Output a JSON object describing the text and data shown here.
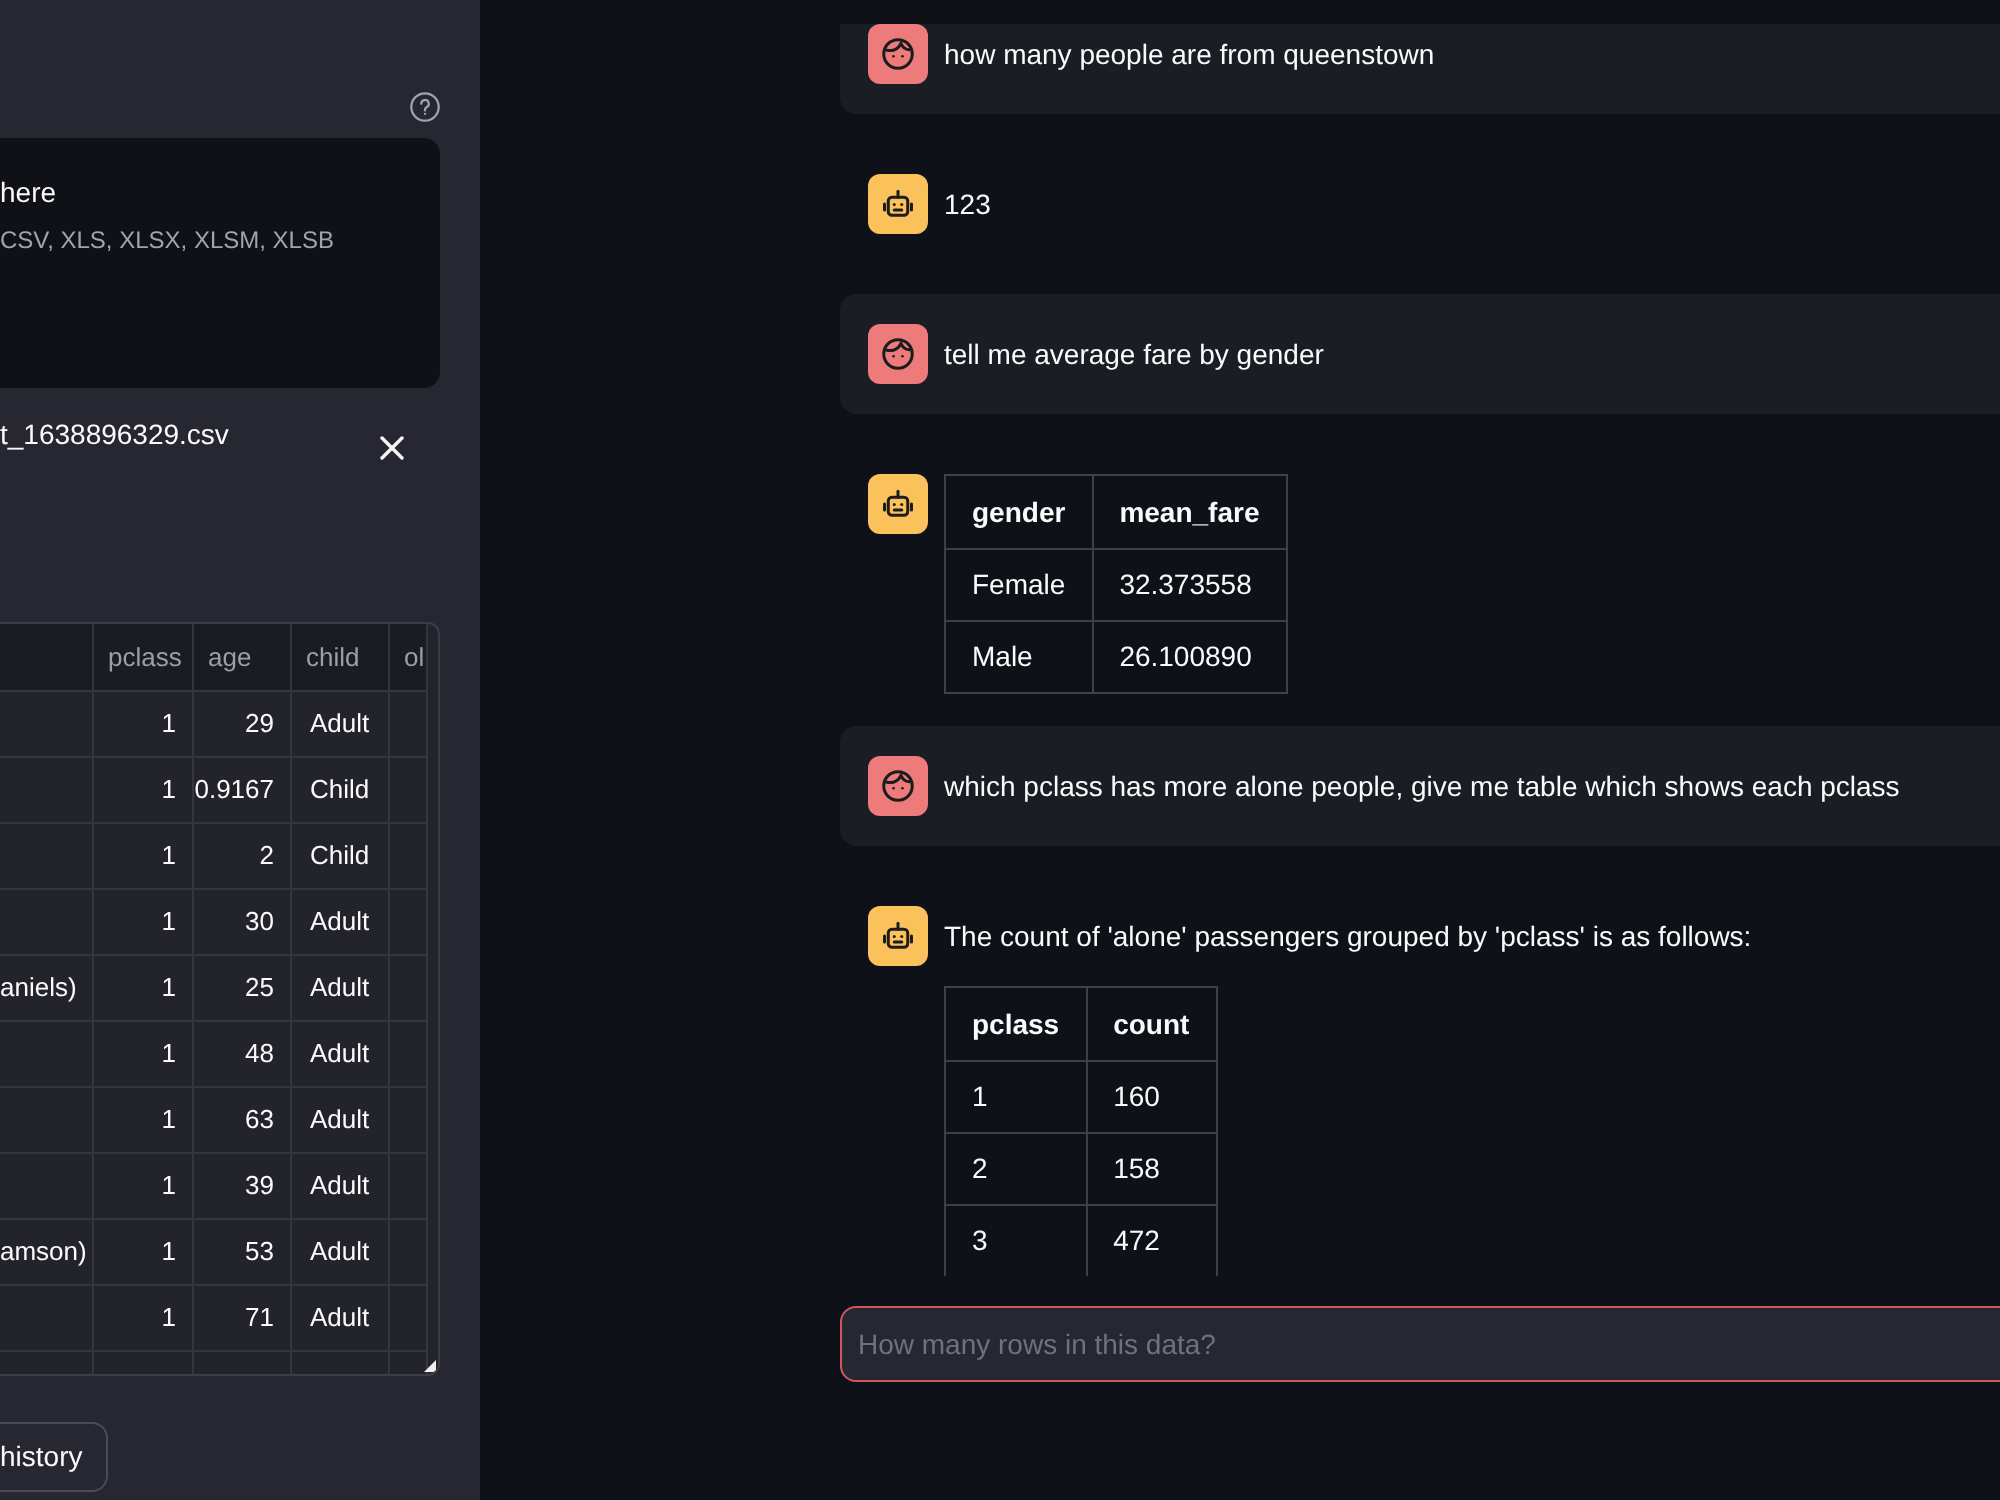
{
  "sidebar": {
    "uploader": {
      "title": "here",
      "hint": "CSV, XLS, XLSX, XLSM, XLSB"
    },
    "uploaded_file": {
      "name": "t_1638896329.csv"
    },
    "data_table": {
      "columns": [
        "pclass",
        "age",
        "child",
        "ol"
      ],
      "rows": [
        {
          "cells": [
            "1",
            "29",
            "Adult"
          ]
        },
        {
          "cells": [
            "1",
            "0.9167",
            "Child"
          ]
        },
        {
          "cells": [
            "1",
            "2",
            "Child"
          ]
        },
        {
          "cells": [
            "1",
            "30",
            "Adult"
          ]
        },
        {
          "column_1": "aniels)",
          "cells": [
            "1",
            "25",
            "Adult"
          ]
        },
        {
          "cells": [
            "1",
            "48",
            "Adult"
          ]
        },
        {
          "cells": [
            "1",
            "63",
            "Adult"
          ]
        },
        {
          "cells": [
            "1",
            "39",
            "Adult"
          ]
        },
        {
          "column_1": "amson)",
          "cells": [
            "1",
            "53",
            "Adult"
          ]
        },
        {
          "cells": [
            "1",
            "71",
            "Adult"
          ]
        }
      ]
    },
    "button": "history"
  },
  "chat": {
    "messages": [
      {
        "kind": "user",
        "text": "how many people are from queenstown"
      },
      {
        "kind": "assistant",
        "text": "123"
      },
      {
        "kind": "user",
        "text": "tell me average fare by gender"
      },
      {
        "kind": "assistant",
        "table": {
          "columns": [
            "gender",
            "mean_fare"
          ],
          "rows": [
            [
              "Female",
              "32.373558"
            ],
            [
              "Male",
              "26.100890"
            ]
          ]
        }
      },
      {
        "kind": "user",
        "text": "which pclass has more alone people, give me table which shows each pclass"
      },
      {
        "kind": "assistant",
        "text": "The count of 'alone' passengers grouped by 'pclass' is as follows:",
        "table": {
          "columns": [
            "pclass",
            "count"
          ],
          "rows": [
            [
              "1",
              "160"
            ],
            [
              "2",
              "158"
            ],
            [
              "3",
              "472"
            ]
          ]
        }
      }
    ]
  },
  "chat_input": {
    "placeholder": "How many rows in this data?"
  }
}
